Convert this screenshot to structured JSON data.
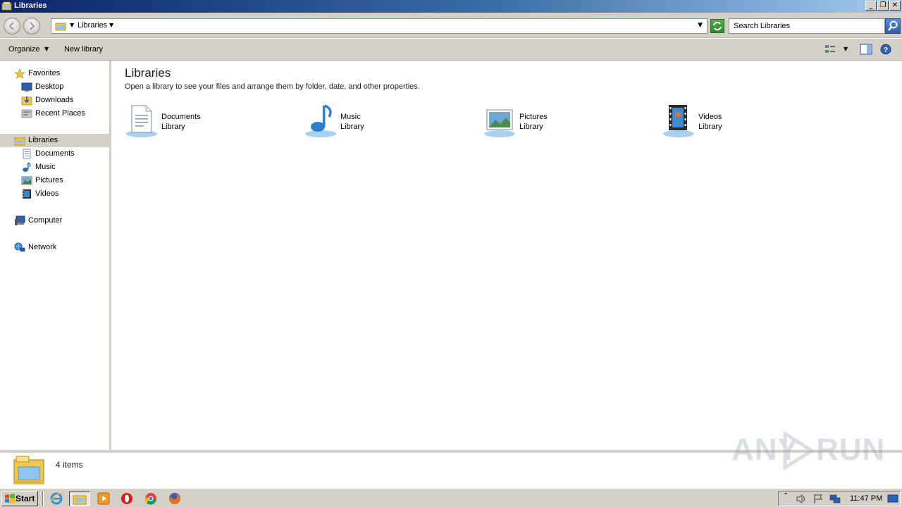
{
  "window": {
    "title": "Libraries",
    "controls": {
      "minimize": "_",
      "restore": "❐",
      "close": "✕"
    }
  },
  "address": {
    "breadcrumb": "Libraries",
    "search_placeholder": "Search Libraries"
  },
  "commands": {
    "organize_label": "Organize",
    "new_library_label": "New library"
  },
  "navigation": {
    "items": [
      {
        "label": "Favorites",
        "icon": "star-icon",
        "level": 0
      },
      {
        "label": "Desktop",
        "icon": "desktop-icon",
        "level": 1
      },
      {
        "label": "Downloads",
        "icon": "downloads-icon",
        "level": 1
      },
      {
        "label": "Recent Places",
        "icon": "recent-places-icon",
        "level": 1
      },
      {
        "label": "Libraries",
        "icon": "libraries-icon",
        "level": 0,
        "selected": true
      },
      {
        "label": "Documents",
        "icon": "documents-icon",
        "level": 1
      },
      {
        "label": "Music",
        "icon": "music-icon",
        "level": 1
      },
      {
        "label": "Pictures",
        "icon": "pictures-icon",
        "level": 1
      },
      {
        "label": "Videos",
        "icon": "videos-icon",
        "level": 1
      },
      {
        "label": "Computer",
        "icon": "computer-icon",
        "level": 0
      },
      {
        "label": "Network",
        "icon": "network-icon",
        "level": 0
      }
    ]
  },
  "main": {
    "title": "Libraries",
    "subtitle": "Open a library to see your files and arrange them by folder, date, and other properties.",
    "libraries": [
      {
        "name": "Documents",
        "type": "Library",
        "icon": "documents-library-icon"
      },
      {
        "name": "Music",
        "type": "Library",
        "icon": "music-library-icon"
      },
      {
        "name": "Pictures",
        "type": "Library",
        "icon": "pictures-library-icon"
      },
      {
        "name": "Videos",
        "type": "Library",
        "icon": "videos-library-icon"
      }
    ]
  },
  "details": {
    "item_count": "4 items"
  },
  "watermark": {
    "text_left": "ANY",
    "text_right": "RUN"
  },
  "taskbar": {
    "start_label": "Start",
    "pinned": [
      "internet-explorer-icon",
      "windows-explorer-icon",
      "media-player-icon",
      "opera-icon",
      "chrome-icon",
      "firefox-icon"
    ],
    "clock": "11:47 PM"
  },
  "colors": {
    "titlebar_start": "#0a246a",
    "titlebar_end": "#a6caf0",
    "chrome": "#d4d0c8",
    "selection": "#d4d0c8"
  }
}
